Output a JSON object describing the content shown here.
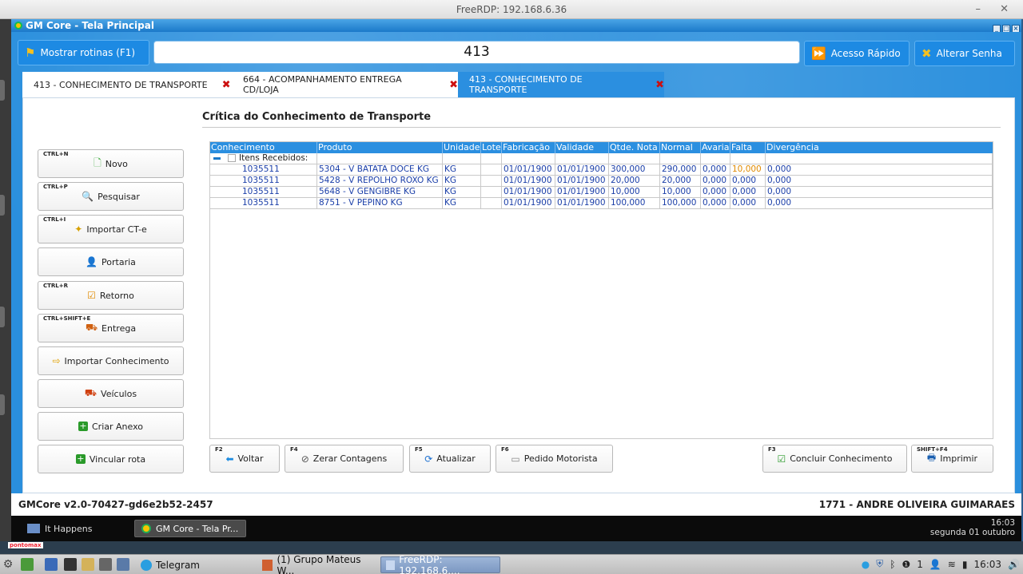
{
  "rdp": {
    "title": "FreeRDP: 192.168.6.36",
    "controls": "– ✕"
  },
  "window": {
    "title": "GM Core - Tela Principal"
  },
  "toolbar": {
    "show_routines": "Mostrar rotinas (F1)",
    "search_value": "413",
    "quick_access": "Acesso Rápido",
    "change_password": "Alterar Senha"
  },
  "tabs": [
    {
      "label": "413 - CONHECIMENTO DE TRANSPORTE",
      "close": "✖"
    },
    {
      "label": "664 - ACOMPANHAMENTO ENTREGA CD/LOJA",
      "close": "✖"
    },
    {
      "label": "413 - CONHECIMENTO DE TRANSPORTE",
      "close": "✖"
    }
  ],
  "sidebar": [
    {
      "shortcut": "CTRL+N",
      "label": "Novo",
      "icon": "new-doc-icon",
      "color": "#3aa83a"
    },
    {
      "shortcut": "CTRL+P",
      "label": "Pesquisar",
      "icon": "search-icon",
      "color": "#1a6fd0"
    },
    {
      "shortcut": "CTRL+I",
      "label": "Importar CT-e",
      "icon": "import-icon",
      "color": "#d7a000"
    },
    {
      "shortcut": "",
      "label": "Portaria",
      "icon": "guard-icon",
      "color": "#2266cc"
    },
    {
      "shortcut": "CTRL+R",
      "label": "Retorno",
      "icon": "checkbox-icon",
      "color": "#e08a00"
    },
    {
      "shortcut": "CTRL+SHIFT+E",
      "label": "Entrega",
      "icon": "delivery-icon",
      "color": "#d06010"
    },
    {
      "shortcut": "",
      "label": "Importar Conhecimento",
      "icon": "import-arrow-icon",
      "color": "#e0a000"
    },
    {
      "shortcut": "",
      "label": "Veículos",
      "icon": "truck-icon",
      "color": "#d04010"
    },
    {
      "shortcut": "",
      "label": "Criar Anexo",
      "icon": "plus-icon",
      "color": "#2a9a2a"
    },
    {
      "shortcut": "",
      "label": "Vincular rota",
      "icon": "plus-icon",
      "color": "#2a9a2a"
    }
  ],
  "section": {
    "title": "Crítica do Conhecimento de Transporte"
  },
  "grid": {
    "columns": [
      "Conhecimento",
      "Produto",
      "Unidade",
      "Lote",
      "Fabricação",
      "Validade",
      "Qtde. Nota",
      "Normal",
      "Avaria",
      "Falta",
      "Divergência"
    ],
    "group_label": "Itens Recebidos:",
    "rows": [
      [
        "1035511",
        "5304 - V BATATA DOCE KG",
        "KG",
        "",
        "01/01/1900",
        "01/01/1900",
        "300,000",
        "290,000",
        "0,000",
        "10,000",
        "0,000"
      ],
      [
        "1035511",
        "5428 - V REPOLHO ROXO KG",
        "KG",
        "",
        "01/01/1900",
        "01/01/1900",
        "20,000",
        "20,000",
        "0,000",
        "0,000",
        "0,000"
      ],
      [
        "1035511",
        "5648 - V GENGIBRE KG",
        "KG",
        "",
        "01/01/1900",
        "01/01/1900",
        "10,000",
        "10,000",
        "0,000",
        "0,000",
        "0,000"
      ],
      [
        "1035511",
        "8751 - V PEPINO KG",
        "KG",
        "",
        "01/01/1900",
        "01/01/1900",
        "100,000",
        "100,000",
        "0,000",
        "0,000",
        "0,000"
      ]
    ]
  },
  "bottom_buttons": [
    {
      "shortcut": "F2",
      "label": "Voltar",
      "icon": "back-arrow-icon"
    },
    {
      "shortcut": "F4",
      "label": "Zerar Contagens",
      "icon": "block-icon"
    },
    {
      "shortcut": "F5",
      "label": "Atualizar",
      "icon": "refresh-icon"
    },
    {
      "shortcut": "F6",
      "label": "Pedido Motorista",
      "icon": "card-icon"
    },
    {
      "shortcut": "F3",
      "label": "Concluir Conhecimento",
      "icon": "check-icon"
    },
    {
      "shortcut": "SHIFT+F4",
      "label": "Imprimir",
      "icon": "printer-icon"
    }
  ],
  "status": {
    "version": "GMCore v2.0-70427-gd6e2b52-2457",
    "user": "1771 - ANDRE OLIVEIRA GUIMARAES"
  },
  "inner_taskbar": {
    "items": [
      "It Happens",
      "GM Core - Tela Pr..."
    ],
    "time": "16:03",
    "date": "segunda 01 outubro"
  },
  "strip": {
    "brand": "pontomax"
  },
  "host_taskbar": {
    "items": [
      "Telegram",
      "(1) Grupo Mateus W...",
      "FreeRDP: 192.168.6...."
    ],
    "tray_count": "1",
    "time": "16:03"
  }
}
